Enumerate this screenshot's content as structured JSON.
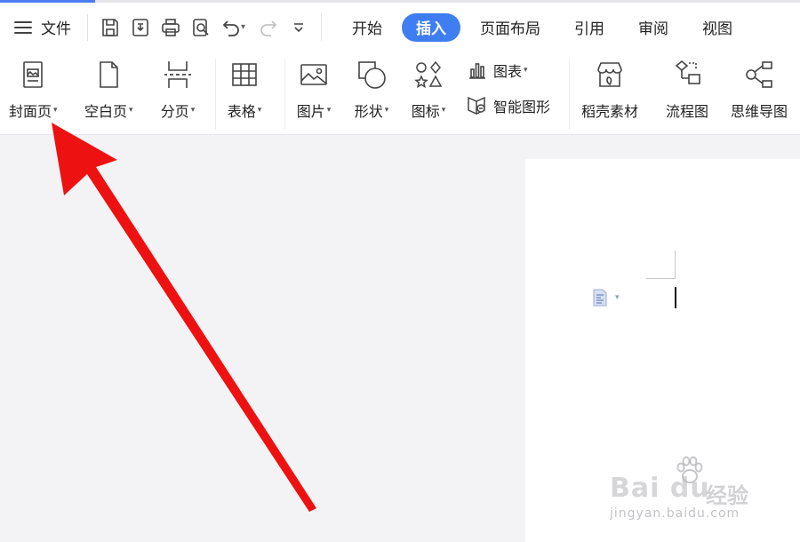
{
  "menu": {
    "file_label": "文件"
  },
  "quick_access": [
    {
      "icon": "save-icon"
    },
    {
      "icon": "export-pdf-icon"
    },
    {
      "icon": "print-icon"
    },
    {
      "icon": "print-preview-icon"
    },
    {
      "icon": "undo-icon"
    },
    {
      "icon": "redo-icon"
    },
    {
      "icon": "customize-icon"
    }
  ],
  "tabs": [
    {
      "label": "开始",
      "active": false
    },
    {
      "label": "插入",
      "active": true
    },
    {
      "label": "页面布局",
      "active": false
    },
    {
      "label": "引用",
      "active": false
    },
    {
      "label": "审阅",
      "active": false
    },
    {
      "label": "视图",
      "active": false
    }
  ],
  "ribbon": {
    "cover_page": "封面页",
    "blank_page": "空白页",
    "page_break": "分页",
    "table": "表格",
    "picture": "图片",
    "shape": "形状",
    "icon_lib": "图标",
    "chart": "图表",
    "smart_graphic": "智能图形",
    "daoke_material": "稻壳素材",
    "flowchart": "流程图",
    "mindmap": "思维导图"
  },
  "watermark": {
    "brand": "Bai du",
    "brand_cn": "经验",
    "url": "jingyan.baidu.com"
  },
  "colors": {
    "accent": "#3f7df2",
    "arrow": "#ee1111"
  }
}
